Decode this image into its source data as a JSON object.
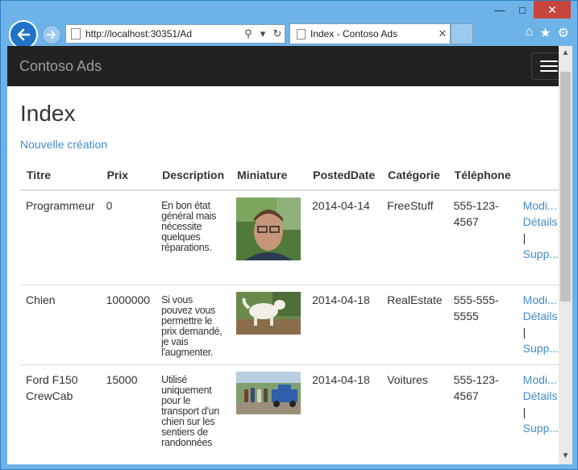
{
  "browser": {
    "url": "http://localhost:30351/Ad",
    "tab_title": "Index - Contoso Ads"
  },
  "navbar": {
    "brand": "Contoso Ads"
  },
  "page": {
    "title": "Index",
    "create_link": "Nouvelle création"
  },
  "table": {
    "headers": [
      "Titre",
      "Prix",
      "Description",
      "Miniature",
      "PostedDate",
      "Catégorie",
      "Téléphone"
    ],
    "rows": [
      {
        "title": "Programmeur",
        "price": "0",
        "description": "En bon état général mais nécessite quelques réparations.",
        "thumbnail": "portrait-photo",
        "posted": "2014-04-14",
        "category": "FreeStuff",
        "phone": "555-123-4567",
        "edit": "Modi...",
        "details": "Détails",
        "delete": "Supp..."
      },
      {
        "title": "Chien",
        "price": "1000000",
        "description": "Si vous pouvez vous permettre le prix demandé, je vais l'augmenter.",
        "thumbnail": "dog-photo",
        "posted": "2014-04-18",
        "category": "RealEstate",
        "phone": "555-555-5555",
        "edit": "Modi...",
        "details": "Détails",
        "delete": "Supp..."
      },
      {
        "title": "Ford F150 CrewCab",
        "price": "15000",
        "description": "Utilisé uniquement pour le transport d'un chien sur les sentiers de randonnées",
        "thumbnail": "truck-photo",
        "posted": "2014-04-18",
        "category": "Voitures",
        "phone": "555-123-4567",
        "edit": "Modi...",
        "details": "Détails",
        "delete": "Supp..."
      }
    ]
  },
  "colors": {
    "navbar": "#222222",
    "link": "#428bca",
    "chrome": "#6db3e8"
  }
}
